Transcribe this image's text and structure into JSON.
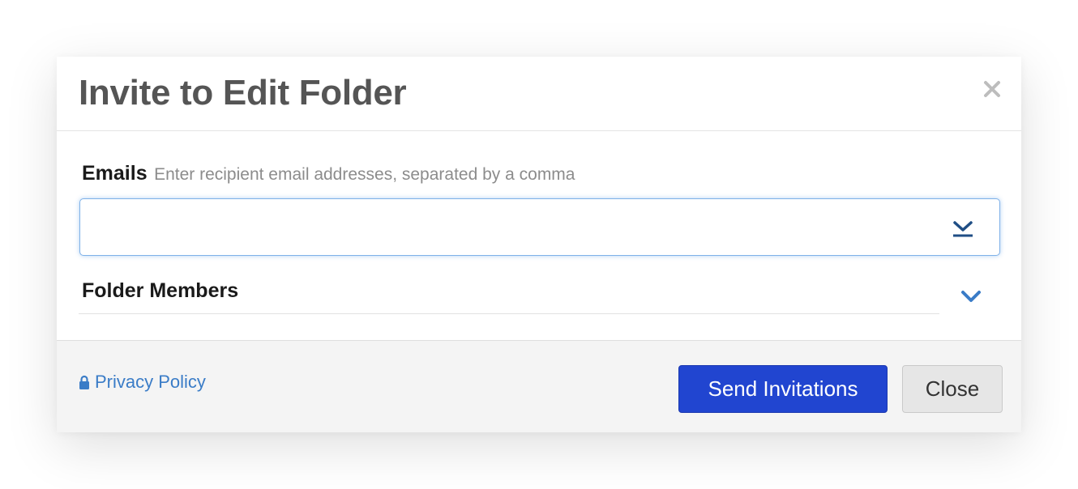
{
  "dialog": {
    "title": "Invite to Edit Folder",
    "close_icon": "close-icon"
  },
  "emails": {
    "label": "Emails",
    "hint": "Enter recipient email addresses, separated by a comma",
    "value": "",
    "dropdown_icon": "chevron-down-underline-icon"
  },
  "members": {
    "label": "Folder Members",
    "toggle_icon": "chevron-down-icon"
  },
  "footer": {
    "privacy_label": "Privacy Policy",
    "privacy_icon": "lock-icon",
    "send_label": "Send Invitations",
    "close_label": "Close"
  },
  "colors": {
    "accent": "#2145d0",
    "link": "#3a7cc7",
    "title": "#555555",
    "input_focus": "#7fb1e8"
  }
}
